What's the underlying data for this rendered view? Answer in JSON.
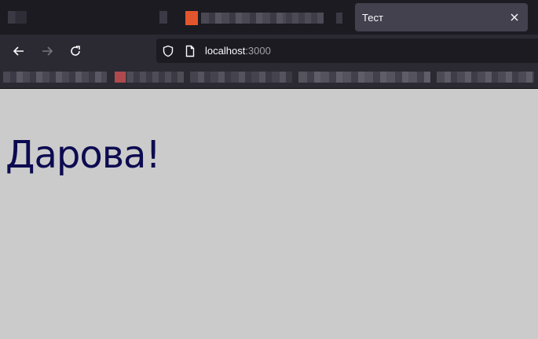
{
  "tab": {
    "title": "Тест"
  },
  "address_bar": {
    "host": "localhost",
    "port": ":3000"
  },
  "page": {
    "heading": "Дарова!"
  },
  "colors": {
    "tabbar_bg": "#1c1b22",
    "toolbar_bg": "#2b2a33",
    "active_tab_bg": "#42414d",
    "page_bg": "#cbcbcb",
    "heading_color": "#0d0b50",
    "favicon_accent": "#e2552d"
  }
}
